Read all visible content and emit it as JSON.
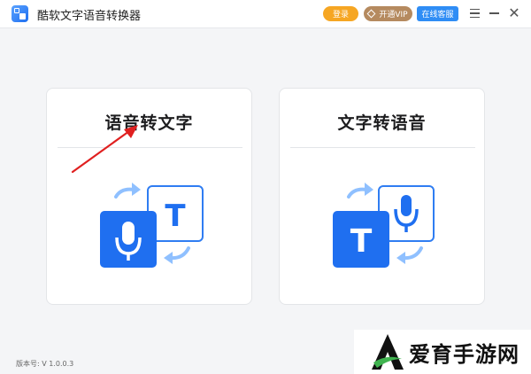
{
  "app": {
    "title": "酷软文字语音转换器",
    "logo_icon": "app-logo-icon"
  },
  "header": {
    "login_label": "登录",
    "vip_label": "开通VIP",
    "service_label": "在线客服",
    "login_color": "#f6a623",
    "vip_color": "#b58a5f",
    "service_color": "#2f8df5"
  },
  "window_controls": {
    "menu_icon": "hamburger-menu-icon",
    "minimize_icon": "minimize-icon",
    "close_icon": "close-icon",
    "close_glyph": "✕"
  },
  "cards": [
    {
      "title": "语音转文字",
      "illustration": "mic-to-text-icon",
      "badge_letter": "T"
    },
    {
      "title": "文字转语音",
      "illustration": "text-to-mic-icon",
      "badge_letter": "T"
    }
  ],
  "footer": {
    "version": "版本号: V 1.0.0.3"
  },
  "watermark": {
    "brand": "爱育手游网"
  },
  "colors": {
    "accent_blue": "#1f6ff0",
    "light_blue": "#5aa2ff",
    "arrow_red": "#e02020"
  }
}
